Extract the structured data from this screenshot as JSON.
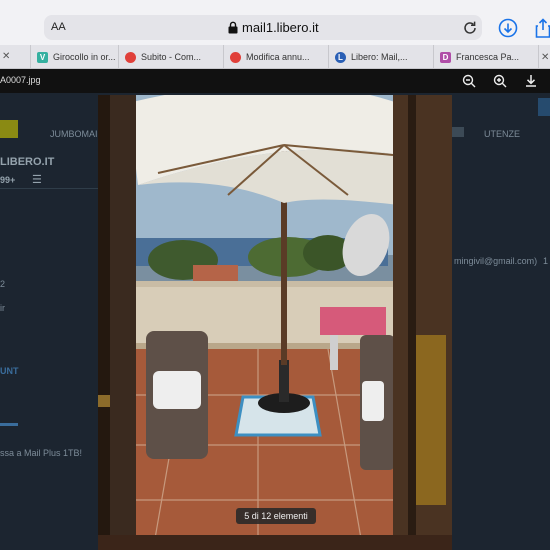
{
  "browser": {
    "text_size_label": "AA",
    "url": "mail1.libero.it"
  },
  "tabs": [
    {
      "label": "Girocollo in or...",
      "favicon_letter": "V",
      "favicon_color": "#35b0a0"
    },
    {
      "label": "Subito - Com...",
      "favicon_letter": "",
      "favicon_color": "#e0403a"
    },
    {
      "label": "Modifica annu...",
      "favicon_letter": "",
      "favicon_color": "#e0403a"
    },
    {
      "label": "Libero: Mail,...",
      "favicon_letter": "L",
      "favicon_color": "#2a5fb5"
    },
    {
      "label": "Francesca Pa...",
      "favicon_letter": "D",
      "favicon_color": "#b04ea8"
    }
  ],
  "viewer": {
    "filename": "A0007.jpg",
    "counter": "5 di 12 elementi"
  },
  "background_page": {
    "menu_item": "JUMBOMAIL",
    "brand": "LIBERO.IT",
    "badge_count": "99+",
    "users_label": "UTENZE",
    "email_fragment": "mingivil@gmail.com)",
    "number_fragment": "2",
    "short_fragment": "ir",
    "account_fragment": "UNT",
    "promo_fragment": "ssa a Mail Plus 1TB!"
  },
  "colors": {
    "accent_blue": "#1a73e8",
    "toolbar_bg": "#f2f2f5"
  }
}
